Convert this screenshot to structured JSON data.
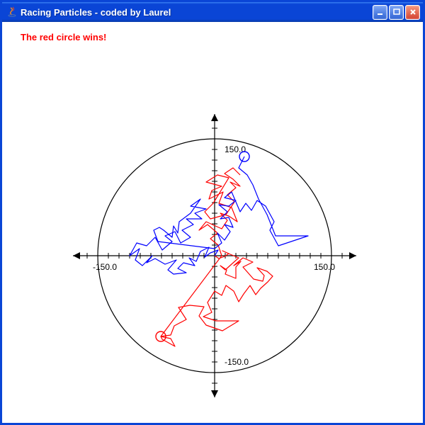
{
  "window": {
    "title": "Racing Particles - coded by Laurel",
    "icon_name": "java-icon",
    "buttons": {
      "minimize": "minimize",
      "maximize": "maximize",
      "close": "close"
    }
  },
  "content": {
    "status_message": "The red circle wins!",
    "status_color": "#ff0000"
  },
  "chart_data": {
    "type": "scatter",
    "title": "",
    "xlabel": "",
    "ylabel": "",
    "xlim": [
      -200,
      200
    ],
    "ylim": [
      -200,
      200
    ],
    "circle_radius": 165,
    "tick_labels": {
      "x_neg": "-150.0",
      "x_pos": "150.0",
      "y_neg": "-150.0",
      "y_pos": "150.0"
    },
    "tick_value": 150,
    "particles": [
      {
        "name": "red",
        "color": "#ff0000",
        "end": [
          -76,
          -114
        ],
        "marker_radius": 7
      },
      {
        "name": "blue",
        "color": "#0000ff",
        "end": [
          42,
          140
        ],
        "marker_radius": 7
      }
    ],
    "series": [
      {
        "name": "red",
        "color": "#ff0000",
        "path": [
          [
            0,
            0
          ],
          [
            6,
            -4
          ],
          [
            14,
            -1
          ],
          [
            20,
            3
          ],
          [
            11,
            7
          ],
          [
            22,
            2
          ],
          [
            34,
            -3
          ],
          [
            25,
            -11
          ],
          [
            15,
            -20
          ],
          [
            8,
            -14
          ],
          [
            17,
            -20
          ],
          [
            15,
            -26
          ],
          [
            30,
            -32
          ],
          [
            30,
            -16
          ],
          [
            37,
            -8
          ],
          [
            27,
            -14
          ],
          [
            40,
            -3
          ],
          [
            54,
            -9
          ],
          [
            40,
            -16
          ],
          [
            55,
            -33
          ],
          [
            68,
            -36
          ],
          [
            70,
            -28
          ],
          [
            60,
            -17
          ],
          [
            74,
            -22
          ],
          [
            82,
            -29
          ],
          [
            75,
            -37
          ],
          [
            65,
            -46
          ],
          [
            58,
            -55
          ],
          [
            50,
            -42
          ],
          [
            41,
            -54
          ],
          [
            34,
            -65
          ],
          [
            27,
            -50
          ],
          [
            16,
            -42
          ],
          [
            10,
            -56
          ],
          [
            0,
            -50
          ],
          [
            -10,
            -66
          ],
          [
            -4,
            -80
          ],
          [
            -16,
            -86
          ],
          [
            2,
            -92
          ],
          [
            34,
            -92
          ],
          [
            11,
            -106
          ],
          [
            -12,
            -98
          ],
          [
            -22,
            -85
          ],
          [
            -15,
            -72
          ],
          [
            -35,
            -70
          ],
          [
            -51,
            -73
          ],
          [
            -40,
            -90
          ],
          [
            -57,
            -99
          ],
          [
            -62,
            -112
          ],
          [
            -76,
            -114
          ],
          [
            -62,
            -117
          ],
          [
            -56,
            -128
          ],
          [
            -74,
            -118
          ],
          [
            -76,
            -114
          ],
          [
            10,
            0
          ],
          [
            5,
            15
          ],
          [
            -6,
            24
          ],
          [
            4,
            32
          ],
          [
            -10,
            44
          ],
          [
            -22,
            36
          ],
          [
            -12,
            48
          ],
          [
            10,
            38
          ],
          [
            18,
            50
          ],
          [
            8,
            60
          ],
          [
            20,
            56
          ],
          [
            32,
            48
          ],
          [
            24,
            68
          ],
          [
            6,
            74
          ],
          [
            12,
            90
          ],
          [
            -8,
            80
          ],
          [
            -4,
            92
          ],
          [
            10,
            98
          ],
          [
            -12,
            104
          ],
          [
            4,
            114
          ],
          [
            20,
            110
          ],
          [
            -2,
            74
          ],
          [
            -14,
            62
          ],
          [
            -6,
            52
          ],
          [
            16,
            58
          ],
          [
            28,
            76
          ],
          [
            18,
            86
          ],
          [
            30,
            96
          ],
          [
            22,
            104
          ],
          [
            36,
            98
          ],
          [
            26,
            108
          ],
          [
            14,
            116
          ],
          [
            26,
            124
          ],
          [
            36,
            114
          ]
        ]
      },
      {
        "name": "blue",
        "color": "#0000ff",
        "path": [
          [
            0,
            0
          ],
          [
            5,
            8
          ],
          [
            -6,
            4
          ],
          [
            -14,
            -2
          ],
          [
            -8,
            12
          ],
          [
            -20,
            6
          ],
          [
            -26,
            -8
          ],
          [
            -36,
            -3
          ],
          [
            -28,
            -14
          ],
          [
            -44,
            -10
          ],
          [
            -52,
            -18
          ],
          [
            -40,
            -24
          ],
          [
            -58,
            -26
          ],
          [
            -66,
            -20
          ],
          [
            -54,
            -6
          ],
          [
            -70,
            -12
          ],
          [
            -84,
            -4
          ],
          [
            -96,
            -10
          ],
          [
            -88,
            0
          ],
          [
            -102,
            -14
          ],
          [
            -112,
            -6
          ],
          [
            -106,
            10
          ],
          [
            -120,
            0
          ],
          [
            -110,
            18
          ],
          [
            -96,
            14
          ],
          [
            -84,
            26
          ],
          [
            -74,
            8
          ],
          [
            -60,
            20
          ],
          [
            -70,
            28
          ],
          [
            -56,
            34
          ],
          [
            -48,
            18
          ],
          [
            -34,
            26
          ],
          [
            -46,
            36
          ],
          [
            -30,
            44
          ],
          [
            -40,
            52
          ],
          [
            -18,
            52
          ],
          [
            -28,
            60
          ],
          [
            -12,
            66
          ],
          [
            -34,
            70
          ],
          [
            -20,
            80
          ],
          [
            -34,
            60
          ],
          [
            -50,
            48
          ],
          [
            -52,
            32
          ],
          [
            -58,
            42
          ],
          [
            -60,
            26
          ],
          [
            -72,
            36
          ],
          [
            -78,
            40
          ],
          [
            -86,
            36
          ],
          [
            -80,
            20
          ],
          [
            0,
            10
          ],
          [
            10,
            18
          ],
          [
            4,
            32
          ],
          [
            14,
            22
          ],
          [
            22,
            34
          ],
          [
            14,
            44
          ],
          [
            26,
            40
          ],
          [
            20,
            54
          ],
          [
            8,
            52
          ],
          [
            18,
            62
          ],
          [
            6,
            72
          ],
          [
            20,
            70
          ],
          [
            30,
            78
          ],
          [
            14,
            82
          ],
          [
            24,
            90
          ],
          [
            36,
            62
          ],
          [
            44,
            74
          ],
          [
            52,
            64
          ],
          [
            60,
            78
          ],
          [
            72,
            70
          ],
          [
            84,
            48
          ],
          [
            78,
            36
          ],
          [
            90,
            14
          ],
          [
            132,
            28
          ],
          [
            86,
            28
          ],
          [
            74,
            58
          ],
          [
            62,
            80
          ],
          [
            54,
            100
          ],
          [
            46,
            114
          ],
          [
            34,
            124
          ],
          [
            40,
            136
          ],
          [
            42,
            140
          ]
        ]
      }
    ]
  }
}
